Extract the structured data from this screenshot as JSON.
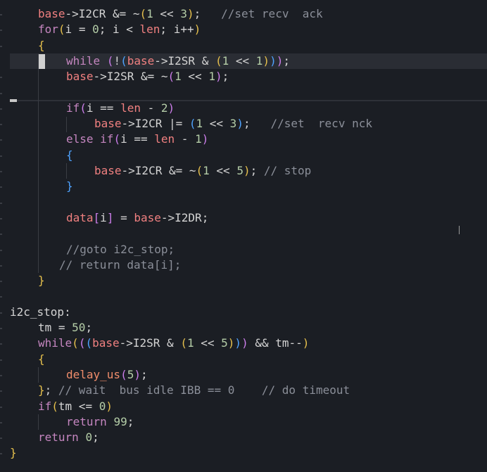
{
  "editor": {
    "lines": [
      {
        "indent": 54,
        "tokens": [
          [
            "var",
            "base"
          ],
          [
            "op",
            "->I2CR &= ~"
          ],
          [
            "p1",
            "("
          ],
          [
            "num",
            "1"
          ],
          [
            "op",
            " << "
          ],
          [
            "num",
            "3"
          ],
          [
            "p1",
            ")"
          ],
          [
            "op",
            ";   "
          ],
          [
            "cmt",
            "//set recv  ack"
          ]
        ]
      },
      {
        "indent": 54,
        "tokens": [
          [
            "kw",
            "for"
          ],
          [
            "p1",
            "("
          ],
          [
            "id",
            "i = "
          ],
          [
            "num",
            "0"
          ],
          [
            "id",
            "; i < "
          ],
          [
            "var",
            "len"
          ],
          [
            "id",
            "; i++"
          ],
          [
            "p1",
            ")"
          ]
        ]
      },
      {
        "indent": 54,
        "tokens": [
          [
            "p1",
            "{"
          ]
        ]
      },
      {
        "indent": 94,
        "current": true,
        "tokens": [
          [
            "kw",
            "while"
          ],
          [
            "id",
            " "
          ],
          [
            "p2",
            "("
          ],
          [
            "id",
            "!"
          ],
          [
            "p3",
            "("
          ],
          [
            "var",
            "base"
          ],
          [
            "op",
            "->I2SR & "
          ],
          [
            "p1",
            "("
          ],
          [
            "num",
            "1"
          ],
          [
            "op",
            " << "
          ],
          [
            "num",
            "1"
          ],
          [
            "p1",
            ")"
          ],
          [
            "p3",
            ")"
          ],
          [
            "p2",
            ")"
          ],
          [
            "op",
            ";"
          ]
        ]
      },
      {
        "indent": 94,
        "tokens": [
          [
            "var",
            "base"
          ],
          [
            "op",
            "->I2SR &= ~"
          ],
          [
            "p2",
            "("
          ],
          [
            "num",
            "1"
          ],
          [
            "op",
            " << "
          ],
          [
            "num",
            "1"
          ],
          [
            "p2",
            ")"
          ],
          [
            "op",
            ";"
          ]
        ]
      },
      {
        "indent": 94,
        "tokens": []
      },
      {
        "indent": 94,
        "tokens": [
          [
            "kw",
            "if"
          ],
          [
            "p2",
            "("
          ],
          [
            "id",
            "i == "
          ],
          [
            "var",
            "len"
          ],
          [
            "op",
            " - "
          ],
          [
            "num",
            "2"
          ],
          [
            "p2",
            ")"
          ]
        ]
      },
      {
        "indent": 134,
        "tokens": [
          [
            "var",
            "base"
          ],
          [
            "op",
            "->I2CR |= "
          ],
          [
            "p3",
            "("
          ],
          [
            "num",
            "1"
          ],
          [
            "op",
            " << "
          ],
          [
            "num",
            "3"
          ],
          [
            "p3",
            ")"
          ],
          [
            "op",
            ";   "
          ],
          [
            "cmt",
            "//set  recv nck"
          ]
        ]
      },
      {
        "indent": 94,
        "tokens": [
          [
            "kw",
            "else"
          ],
          [
            "id",
            " "
          ],
          [
            "kw",
            "if"
          ],
          [
            "p2",
            "("
          ],
          [
            "id",
            "i == "
          ],
          [
            "var",
            "len"
          ],
          [
            "op",
            " - "
          ],
          [
            "num",
            "1"
          ],
          [
            "p2",
            ")"
          ]
        ]
      },
      {
        "indent": 94,
        "tokens": [
          [
            "p3",
            "{"
          ]
        ]
      },
      {
        "indent": 134,
        "tokens": [
          [
            "var",
            "base"
          ],
          [
            "op",
            "->I2CR &= ~"
          ],
          [
            "p1",
            "("
          ],
          [
            "num",
            "1"
          ],
          [
            "op",
            " << "
          ],
          [
            "num",
            "5"
          ],
          [
            "p1",
            ")"
          ],
          [
            "op",
            "; "
          ],
          [
            "cmt",
            "// stop"
          ]
        ]
      },
      {
        "indent": 94,
        "tokens": [
          [
            "p3",
            "}"
          ]
        ]
      },
      {
        "indent": 94,
        "tokens": []
      },
      {
        "indent": 94,
        "tokens": [
          [
            "var",
            "data"
          ],
          [
            "p2",
            "["
          ],
          [
            "id",
            "i"
          ],
          [
            "p2",
            "]"
          ],
          [
            "op",
            " = "
          ],
          [
            "var",
            "base"
          ],
          [
            "op",
            "->I2DR;"
          ]
        ]
      },
      {
        "indent": 94,
        "tokens": []
      },
      {
        "indent": 94,
        "tokens": [
          [
            "cmt",
            "//goto i2c_stop;"
          ]
        ]
      },
      {
        "indent": 84,
        "tokens": [
          [
            "cmt",
            "// return data[i];"
          ]
        ]
      },
      {
        "indent": 54,
        "tokens": [
          [
            "p1",
            "}"
          ]
        ]
      },
      {
        "indent": 14,
        "tokens": []
      },
      {
        "indent": 14,
        "tokens": [
          [
            "lbl",
            "i2c_stop:"
          ]
        ]
      },
      {
        "indent": 54,
        "tokens": [
          [
            "id",
            "tm = "
          ],
          [
            "num",
            "50"
          ],
          [
            "op",
            ";"
          ]
        ]
      },
      {
        "indent": 54,
        "tokens": [
          [
            "kw",
            "while"
          ],
          [
            "p1",
            "("
          ],
          [
            "p2",
            "("
          ],
          [
            "p3",
            "("
          ],
          [
            "var",
            "base"
          ],
          [
            "op",
            "->I2SR & "
          ],
          [
            "p1",
            "("
          ],
          [
            "num",
            "1"
          ],
          [
            "op",
            " << "
          ],
          [
            "num",
            "5"
          ],
          [
            "p1",
            ")"
          ],
          [
            "p3",
            ")"
          ],
          [
            "p2",
            ")"
          ],
          [
            "op",
            " && tm--"
          ],
          [
            "p1",
            ")"
          ]
        ]
      },
      {
        "indent": 54,
        "tokens": [
          [
            "p1",
            "{"
          ]
        ]
      },
      {
        "indent": 94,
        "tokens": [
          [
            "fn",
            "delay_us"
          ],
          [
            "p2",
            "("
          ],
          [
            "num",
            "5"
          ],
          [
            "p2",
            ")"
          ],
          [
            "op",
            ";"
          ]
        ]
      },
      {
        "indent": 54,
        "tokens": [
          [
            "p1",
            "}"
          ],
          [
            "op",
            "; "
          ],
          [
            "cmt",
            "// wait  bus idle IBB == 0    // do timeout"
          ]
        ]
      },
      {
        "indent": 54,
        "tokens": [
          [
            "kw",
            "if"
          ],
          [
            "p1",
            "("
          ],
          [
            "id",
            "tm <= "
          ],
          [
            "num",
            "0"
          ],
          [
            "p1",
            ")"
          ]
        ]
      },
      {
        "indent": 94,
        "tokens": [
          [
            "kw",
            "return"
          ],
          [
            "id",
            " "
          ],
          [
            "num",
            "99"
          ],
          [
            "op",
            ";"
          ]
        ]
      },
      {
        "indent": 54,
        "tokens": [
          [
            "kw",
            "return"
          ],
          [
            "id",
            " "
          ],
          [
            "num",
            "0"
          ],
          [
            "op",
            ";"
          ]
        ]
      },
      {
        "indent": 14,
        "tokens": [
          [
            "p1",
            "}"
          ]
        ]
      }
    ]
  }
}
